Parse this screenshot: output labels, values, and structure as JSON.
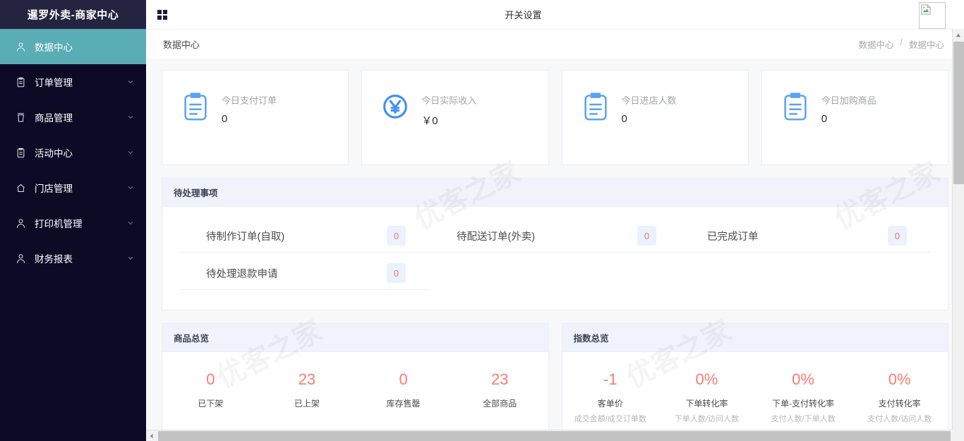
{
  "sidebar": {
    "brand": "暹罗外卖-商家中心",
    "items": [
      {
        "label": "数据中心",
        "icon": "user-icon",
        "active": true,
        "expandable": false
      },
      {
        "label": "订单管理",
        "icon": "clipboard-icon",
        "active": false,
        "expandable": true
      },
      {
        "label": "商品管理",
        "icon": "cup-icon",
        "active": false,
        "expandable": true
      },
      {
        "label": "活动中心",
        "icon": "clipboard-icon",
        "active": false,
        "expandable": true
      },
      {
        "label": "门店管理",
        "icon": "home-icon",
        "active": false,
        "expandable": true
      },
      {
        "label": "打印机管理",
        "icon": "user-icon",
        "active": false,
        "expandable": true
      },
      {
        "label": "财务报表",
        "icon": "user-icon",
        "active": false,
        "expandable": true
      }
    ]
  },
  "topbar": {
    "menu_toggle_icon": "grid-icon",
    "title": "开关设置",
    "avatar_icon": "broken-image-icon"
  },
  "breadcrumb": {
    "page_title": "数据中心",
    "trail": [
      "数据中心",
      "数据中心"
    ],
    "separator": "/"
  },
  "stats": [
    {
      "icon": "clipboard-icon",
      "label": "今日支付订单",
      "value": "0"
    },
    {
      "icon": "yuan-circle-icon",
      "label": "今日实际收入",
      "value": "￥0"
    },
    {
      "icon": "clipboard-icon",
      "label": "今日进店人数",
      "value": "0"
    },
    {
      "icon": "clipboard-icon",
      "label": "今日加购商品",
      "value": "0"
    }
  ],
  "todo_panel": {
    "title": "待处理事项",
    "items": [
      {
        "label": "待制作订单(自取)",
        "count": "0"
      },
      {
        "label": "待配送订单(外卖)",
        "count": "0"
      },
      {
        "label": "已完成订单",
        "count": "0"
      },
      {
        "label": "待处理退款申请",
        "count": "0"
      }
    ]
  },
  "goods_panel": {
    "title": "商品总览",
    "items": [
      {
        "value": "0",
        "name": "已下架",
        "sub": ""
      },
      {
        "value": "23",
        "name": "已上架",
        "sub": ""
      },
      {
        "value": "0",
        "name": "库存售罄",
        "sub": ""
      },
      {
        "value": "23",
        "name": "全部商品",
        "sub": ""
      }
    ]
  },
  "index_panel": {
    "title": "指数总览",
    "items": [
      {
        "value": "-1",
        "name": "客单价",
        "sub": "成交金额/成交订单数"
      },
      {
        "value": "0%",
        "name": "下单转化率",
        "sub": "下单人数/访问人数"
      },
      {
        "value": "0%",
        "name": "下单-支付转化率",
        "sub": "支付人数/下单人数"
      },
      {
        "value": "0%",
        "name": "支付转化率",
        "sub": "支付人数/访问人数"
      }
    ]
  },
  "watermark": {
    "text": "优客之家"
  },
  "colors": {
    "sidebar_bg": "#0d0a26",
    "sidebar_brand_bg": "#242440",
    "sidebar_active": "#5aacb5",
    "page_bg": "#f7f8fa",
    "panel_head_bg": "#f0f3fc",
    "accent_blue": "#409eff",
    "danger_red": "#fb7b72",
    "badge_bg": "#e9f2fd"
  },
  "scrollbars": {
    "vertical_visible": true,
    "horizontal_visible": true
  }
}
